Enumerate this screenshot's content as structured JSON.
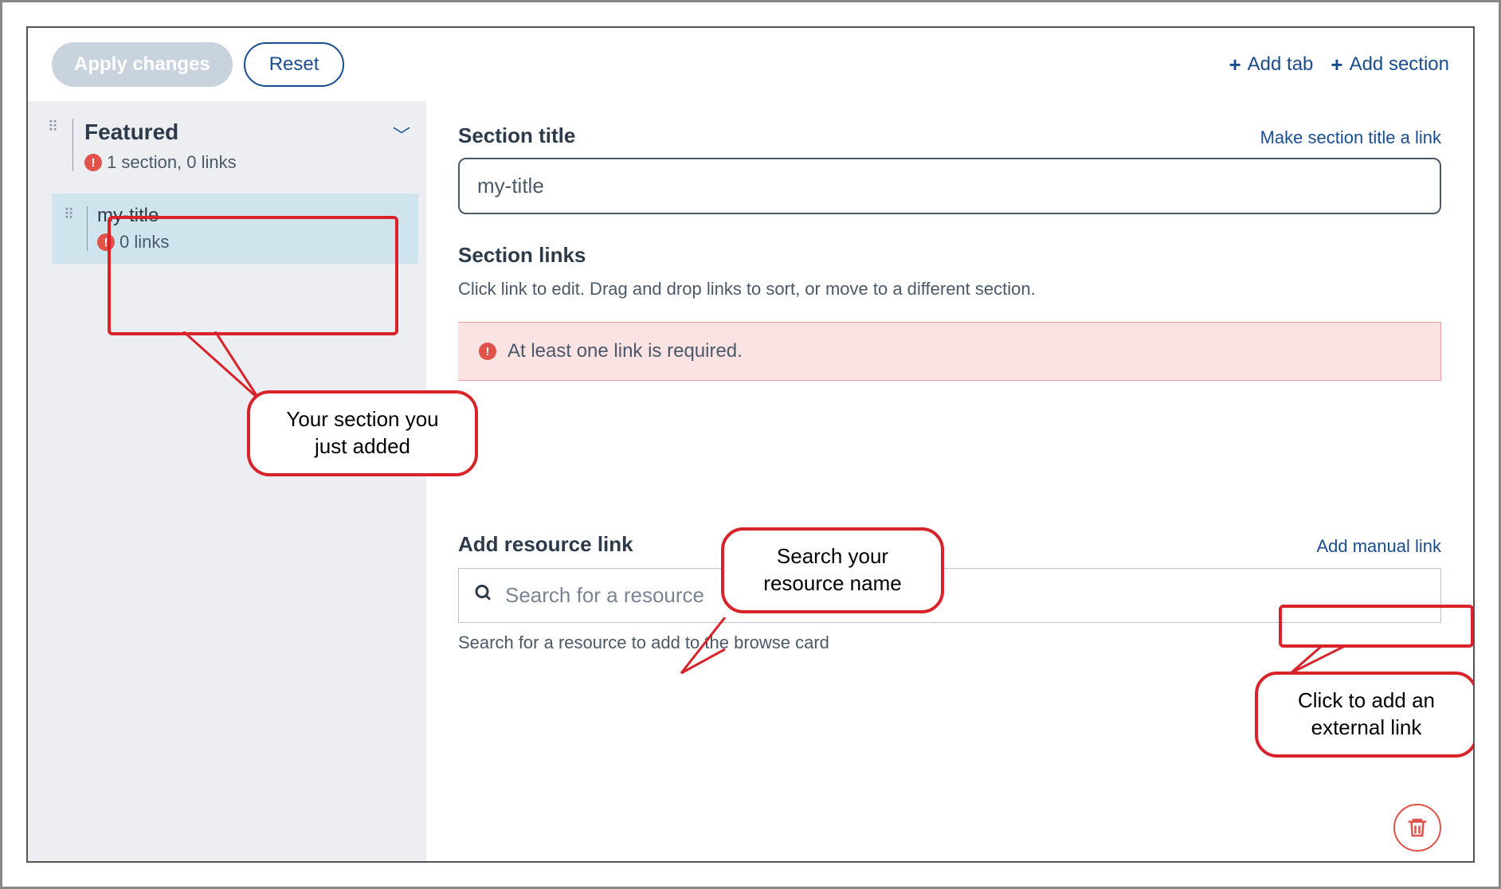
{
  "toolbar": {
    "apply_label": "Apply changes",
    "reset_label": "Reset",
    "add_tab_label": "Add tab",
    "add_section_label": "Add section"
  },
  "sidebar": {
    "accordion": {
      "title": "Featured",
      "subtitle": "1 section, 0 links"
    },
    "items": [
      {
        "title": "my-title",
        "subtitle": "0 links"
      }
    ]
  },
  "annotations": {
    "section_added": "Your section you just added",
    "search_hint": "Search your resource name",
    "manual_link_hint": "Click to add an external link"
  },
  "main": {
    "section_title_label": "Section title",
    "make_link_action": "Make section title a link",
    "section_title_value": "my-title",
    "section_links_label": "Section links",
    "section_links_help": "Click link to edit. Drag and drop links to sort, or move to a different section.",
    "error_message": "At least one link is required.",
    "add_resource_label": "Add resource link",
    "add_manual_link_label": "Add manual link",
    "search_placeholder": "Search for a resource",
    "search_help": "Search for a resource to add to the browse card"
  }
}
